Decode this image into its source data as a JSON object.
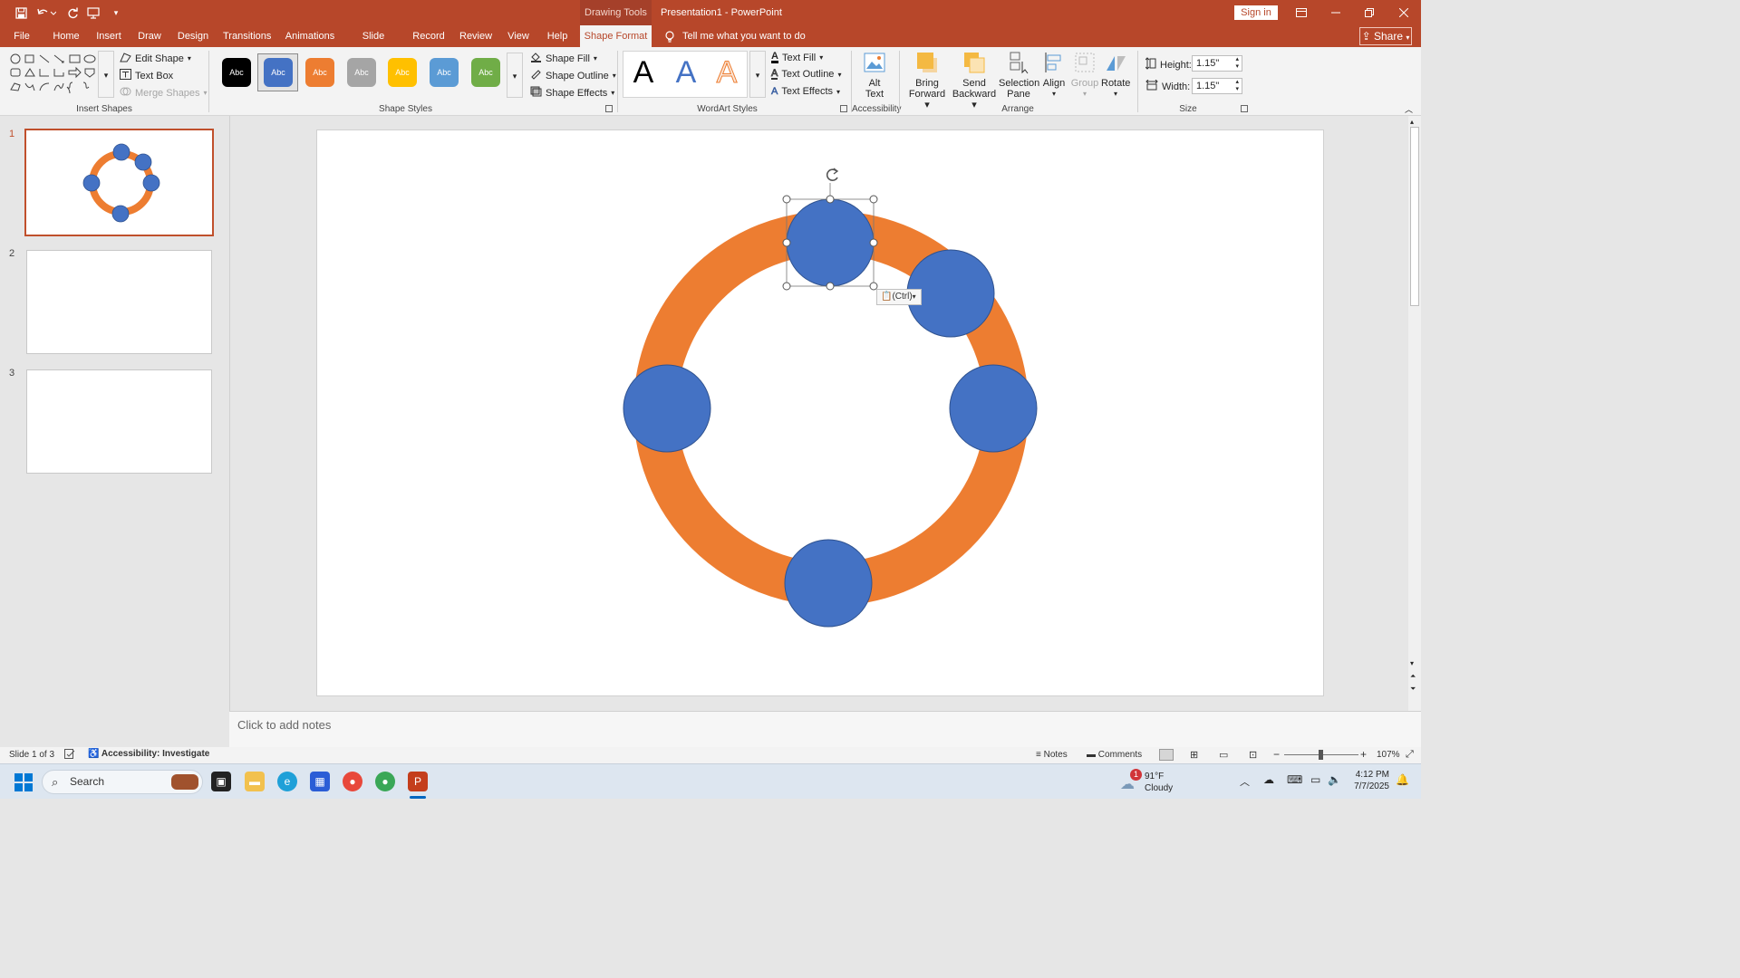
{
  "title_bar": {
    "context_label": "Drawing Tools",
    "doc_title": "Presentation1 - PowerPoint",
    "sign_in": "Sign in"
  },
  "tabs": [
    "File",
    "Home",
    "Insert",
    "Draw",
    "Design",
    "Transitions",
    "Animations",
    "Slide Show",
    "Record",
    "Review",
    "View",
    "Help",
    "Shape Format"
  ],
  "active_tab": "Shape Format",
  "tell_me": "Tell me what you want to do",
  "share": "Share",
  "ribbon": {
    "insert_shapes": {
      "label": "Insert Shapes",
      "edit_shape": "Edit Shape",
      "text_box": "Text Box",
      "merge_shapes": "Merge Shapes"
    },
    "shape_styles": {
      "label": "Shape Styles",
      "swatch_text": "Abc",
      "swatches": [
        "#000000",
        "#4472c4",
        "#ed7d31",
        "#a5a5a5",
        "#ffc000",
        "#5b9bd5",
        "#70ad47"
      ],
      "shape_fill": "Shape Fill",
      "shape_outline": "Shape Outline",
      "shape_effects": "Shape Effects"
    },
    "wordart_styles": {
      "label": "WordArt Styles",
      "glyph": "A",
      "text_fill": "Text Fill",
      "text_outline": "Text Outline",
      "text_effects": "Text Effects"
    },
    "accessibility": {
      "label": "Accessibility",
      "alt_text_1": "Alt",
      "alt_text_2": "Text"
    },
    "arrange": {
      "label": "Arrange",
      "bring_forward_1": "Bring",
      "bring_forward_2": "Forward",
      "send_backward_1": "Send",
      "send_backward_2": "Backward",
      "selection_pane_1": "Selection",
      "selection_pane_2": "Pane",
      "align": "Align",
      "group": "Group",
      "rotate": "Rotate"
    },
    "size": {
      "label": "Size",
      "height_label": "Height:",
      "height_value": "1.15\"",
      "width_label": "Width:",
      "width_value": "1.15\""
    }
  },
  "slides": [
    {
      "number": "1"
    },
    {
      "number": "2"
    },
    {
      "number": "3"
    }
  ],
  "paste_options": "(Ctrl)",
  "notes_placeholder": "Click to add notes",
  "status": {
    "slide_info": "Slide 1 of 3",
    "accessibility": "Accessibility: Investigate",
    "notes": "Notes",
    "comments": "Comments",
    "zoom": "107%"
  },
  "taskbar": {
    "search": "Search",
    "weather_temp": "91°F",
    "weather_desc": "Cloudy",
    "weather_badge": "1",
    "time": "4:12 PM",
    "date": "7/7/2025"
  },
  "colors": {
    "accent": "#b7472a",
    "ring": "#ed7d31",
    "circle": "#4472c4",
    "circle_border": "#2f528f"
  }
}
